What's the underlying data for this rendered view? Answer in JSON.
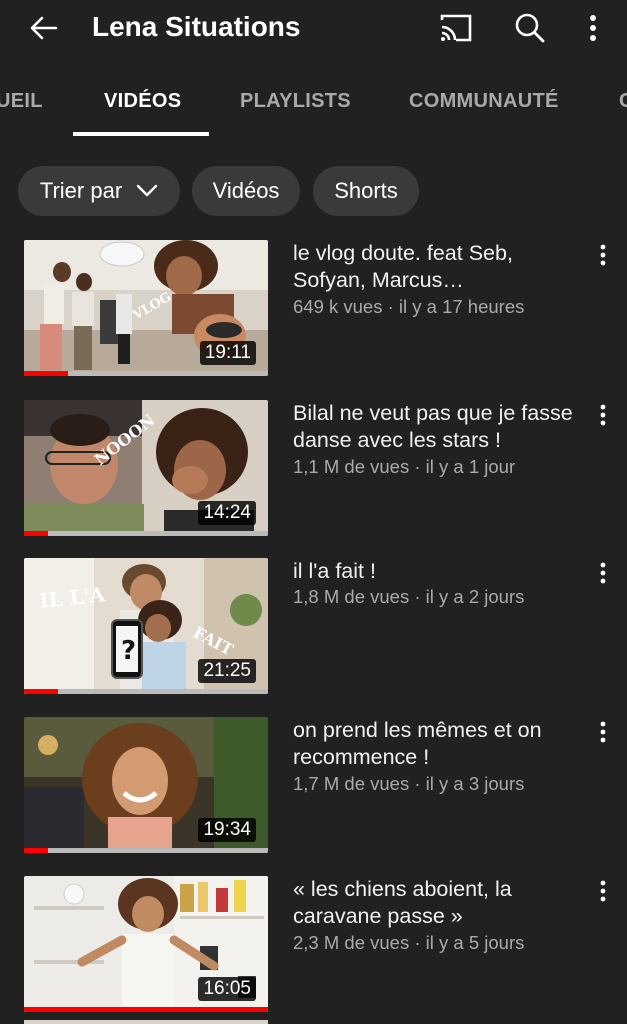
{
  "header": {
    "title": "Lena Situations",
    "icons": [
      "back-arrow-icon",
      "cast-icon",
      "search-icon",
      "more-vert-icon"
    ]
  },
  "tabs": [
    {
      "label": "UEIL",
      "active": false
    },
    {
      "label": "VIDÉOS",
      "active": true
    },
    {
      "label": "PLAYLISTS",
      "active": false
    },
    {
      "label": "COMMUNAUTÉ",
      "active": false
    },
    {
      "label": "C",
      "active": false
    }
  ],
  "chips": {
    "sort_label": "Trier par",
    "videos_label": "Vidéos",
    "shorts_label": "Shorts"
  },
  "videos": [
    {
      "title": "le vlog doute. feat Seb, Sofyan, Marcus…",
      "meta": "649 k vues · il y a 17 heures",
      "duration": "19:11",
      "watched_fraction": 0.18
    },
    {
      "title": "Bilal ne veut pas que je fasse danse avec les stars !",
      "meta": "1,1 M de vues · il y a 1 jour",
      "duration": "14:24",
      "watched_fraction": 0.1
    },
    {
      "title": "il l'a fait !",
      "meta": "1,8 M de vues · il y a 2 jours",
      "duration": "21:25",
      "watched_fraction": 0.14
    },
    {
      "title": "on prend les mêmes et on recommence !",
      "meta": "1,7 M de vues · il y a 3 jours",
      "duration": "19:34",
      "watched_fraction": 0.1
    },
    {
      "title": "« les chiens aboient, la caravane passe »",
      "meta": "2,3 M de vues · il y a 5 jours",
      "duration": "16:05",
      "watched_fraction": 1.0
    }
  ],
  "colors": {
    "background": "#212121",
    "chip": "#3a3a3a",
    "progress": "#ff0000",
    "secondary_text": "#aaaaaa"
  }
}
